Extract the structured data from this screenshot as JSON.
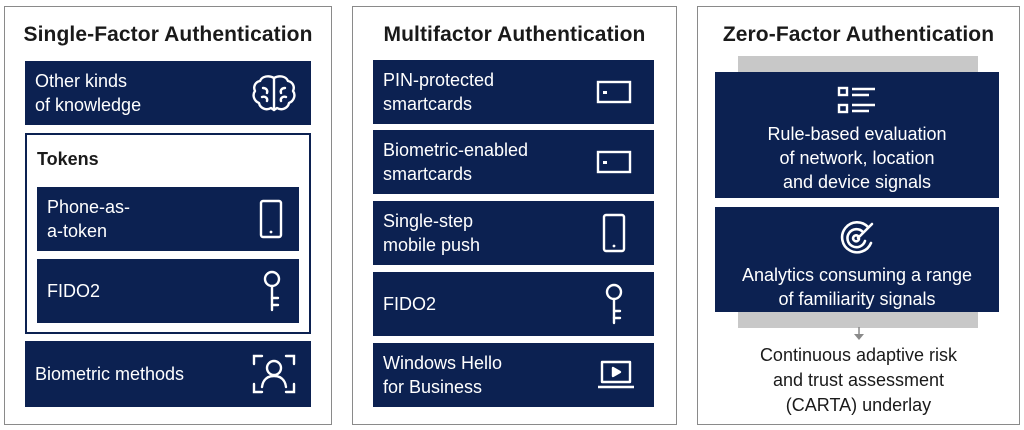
{
  "single_factor": {
    "title": "Single-Factor Authentication",
    "knowledge": {
      "label": "Other kinds\nof knowledge",
      "icon": "brain-icon"
    },
    "tokens": {
      "heading": "Tokens",
      "phone": {
        "label": "Phone-as-\na-token",
        "icon": "phone-icon"
      },
      "fido": {
        "label": "FIDO2",
        "icon": "key-icon"
      }
    },
    "biometric": {
      "label": "Biometric methods",
      "icon": "face-scan-icon"
    }
  },
  "multifactor": {
    "title": "Multifactor Authentication",
    "items": [
      {
        "label": "PIN-protected\nsmartcards",
        "icon": "smartcard-icon"
      },
      {
        "label": "Biometric-enabled\nsmartcards",
        "icon": "smartcard-icon"
      },
      {
        "label": "Single-step\nmobile push",
        "icon": "phone-icon"
      },
      {
        "label": "FIDO2",
        "icon": "key-icon"
      },
      {
        "label": "Windows Hello\nfor Business",
        "icon": "laptop-icon"
      }
    ]
  },
  "zero_factor": {
    "title": "Zero-Factor Authentication",
    "rules": {
      "label": "Rule-based evaluation\nof network, location\nand device signals",
      "icon": "list-icon"
    },
    "analytics": {
      "label": "Analytics consuming a range\nof familiarity signals",
      "icon": "target-icon"
    },
    "carta": "Continuous adaptive risk\nand trust assessment\n(CARTA) underlay"
  },
  "colors": {
    "navy": "#0c2151",
    "grey": "#c8c8c8",
    "border": "#8a8a8a"
  }
}
